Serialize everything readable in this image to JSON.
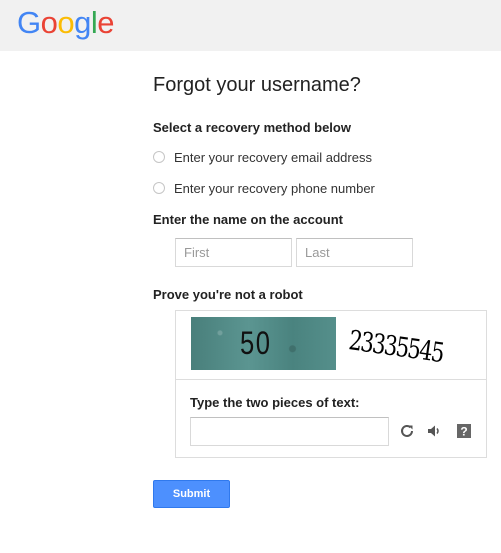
{
  "header": {
    "logo_letters": [
      {
        "char": "G",
        "color": "#4285f4"
      },
      {
        "char": "o",
        "color": "#ea4335"
      },
      {
        "char": "o",
        "color": "#fbbc05"
      },
      {
        "char": "g",
        "color": "#4285f4"
      },
      {
        "char": "l",
        "color": "#34a853"
      },
      {
        "char": "e",
        "color": "#ea4335"
      }
    ]
  },
  "main": {
    "title": "Forgot your username?",
    "recovery": {
      "label": "Select a recovery method below",
      "options": [
        {
          "label": "Enter your recovery email address"
        },
        {
          "label": "Enter your recovery phone number"
        }
      ]
    },
    "name": {
      "label": "Enter the name on the account",
      "first_placeholder": "First",
      "last_placeholder": "Last"
    },
    "captcha": {
      "label": "Prove you're not a robot",
      "image1_text": "50",
      "image2_text": "23335545",
      "prompt": "Type the two pieces of text:",
      "icons": [
        "refresh-icon",
        "audio-icon",
        "help-icon"
      ]
    },
    "submit_label": "Submit"
  },
  "colors": {
    "header_bg": "#f1f1f1",
    "button_blue": "#4d90fe"
  }
}
